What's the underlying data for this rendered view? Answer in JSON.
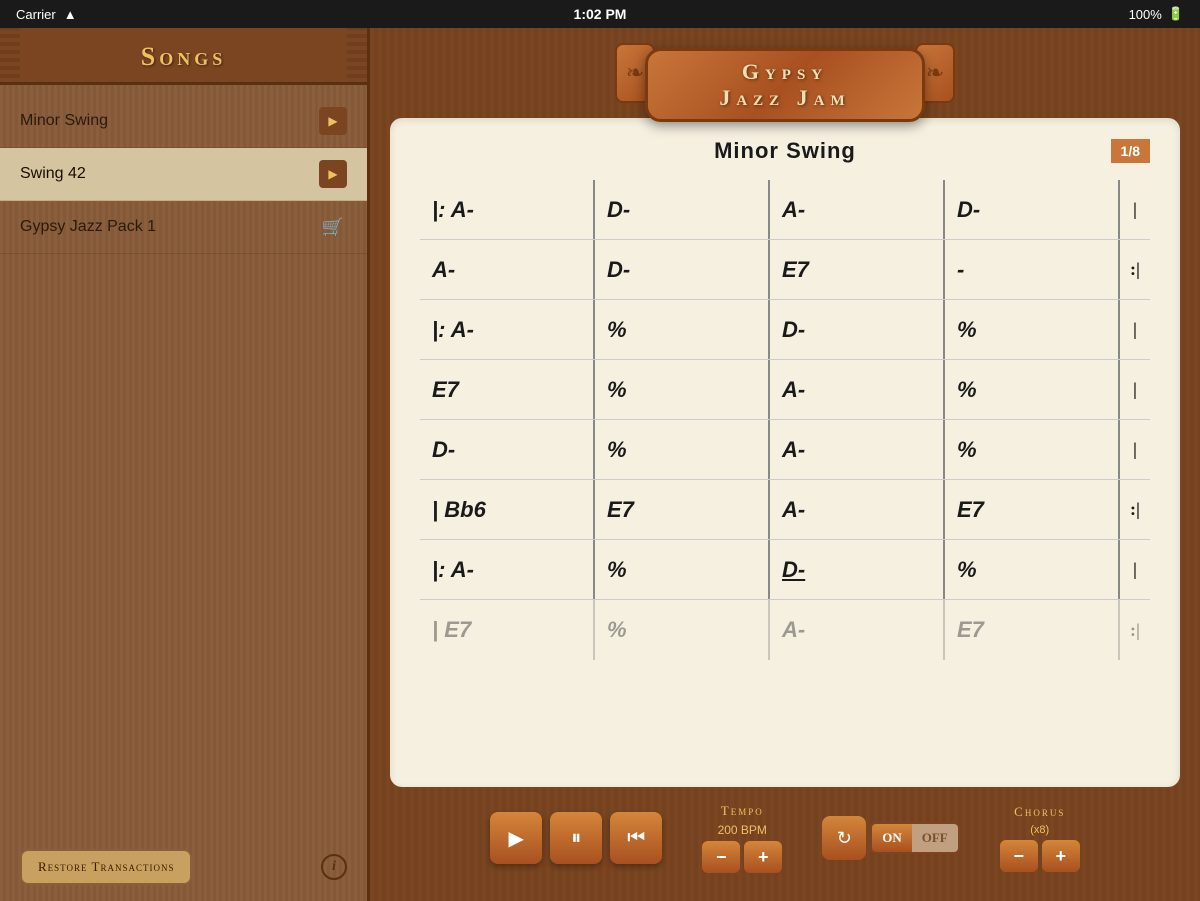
{
  "statusBar": {
    "carrier": "Carrier",
    "time": "1:02 PM",
    "battery": "100%"
  },
  "sidebar": {
    "title": "Songs",
    "songs": [
      {
        "id": 1,
        "name": "Minor Swing",
        "type": "play",
        "selected": false
      },
      {
        "id": 2,
        "name": "Swing 42",
        "type": "play",
        "selected": true
      },
      {
        "id": 3,
        "name": "Gypsy Jazz Pack 1",
        "type": "cart",
        "selected": false
      }
    ],
    "restoreButton": "Restore Transactions",
    "infoLabel": "i"
  },
  "appHeader": {
    "line1": "Gypsy",
    "line2": "Jazz Jam",
    "leftBracket": "❧",
    "rightBracket": "❧"
  },
  "sheet": {
    "songTitle": "Minor Swing",
    "pageIndicator": "1/8",
    "rows": [
      {
        "cells": [
          {
            "prefix": "|:",
            "text": "A-",
            "underline": false
          },
          {
            "prefix": "",
            "text": "D-",
            "underline": false
          },
          {
            "prefix": "",
            "text": "A-",
            "underline": false
          },
          {
            "prefix": "",
            "text": "D-",
            "underline": false
          }
        ],
        "end": "|"
      },
      {
        "cells": [
          {
            "prefix": "",
            "text": "A-",
            "underline": false
          },
          {
            "prefix": "",
            "text": "D-",
            "underline": false
          },
          {
            "prefix": "",
            "text": "E7",
            "underline": false
          },
          {
            "prefix": "",
            "text": "-",
            "underline": false
          }
        ],
        "end": ":|"
      },
      {
        "cells": [
          {
            "prefix": "|:",
            "text": "A-",
            "underline": false
          },
          {
            "prefix": "",
            "text": "%",
            "underline": false
          },
          {
            "prefix": "",
            "text": "D-",
            "underline": false
          },
          {
            "prefix": "",
            "text": "%",
            "underline": false
          }
        ],
        "end": "|"
      },
      {
        "cells": [
          {
            "prefix": "",
            "text": "E7",
            "underline": false
          },
          {
            "prefix": "",
            "text": "%",
            "underline": false
          },
          {
            "prefix": "",
            "text": "A-",
            "underline": false
          },
          {
            "prefix": "",
            "text": "%",
            "underline": false
          }
        ],
        "end": "|"
      },
      {
        "cells": [
          {
            "prefix": "",
            "text": "D-",
            "underline": false
          },
          {
            "prefix": "",
            "text": "%",
            "underline": false
          },
          {
            "prefix": "",
            "text": "A-",
            "underline": false
          },
          {
            "prefix": "",
            "text": "%",
            "underline": false
          }
        ],
        "end": "|"
      },
      {
        "cells": [
          {
            "prefix": "|",
            "text": "Bb6",
            "underline": false
          },
          {
            "prefix": "",
            "text": "E7",
            "underline": false
          },
          {
            "prefix": "",
            "text": "A-",
            "underline": false
          },
          {
            "prefix": "",
            "text": "E7",
            "underline": false
          }
        ],
        "end": ":|"
      },
      {
        "cells": [
          {
            "prefix": "|:",
            "text": "A-",
            "underline": false
          },
          {
            "prefix": "",
            "text": "%",
            "underline": false
          },
          {
            "prefix": "",
            "text": "D-",
            "underline": true
          },
          {
            "prefix": "",
            "text": "%",
            "underline": false
          }
        ],
        "end": "|"
      },
      {
        "cells": [
          {
            "prefix": "|",
            "text": "E7",
            "underline": false
          },
          {
            "prefix": "",
            "text": "%",
            "underline": false
          },
          {
            "prefix": "",
            "text": "A-",
            "underline": false
          },
          {
            "prefix": "",
            "text": "E7",
            "underline": false
          }
        ],
        "end": ":|",
        "partial": true
      }
    ]
  },
  "controls": {
    "playLabel": "▶",
    "pauseLabel": "⏸",
    "rewindLabel": "⏮",
    "tempoLabel": "Tempo",
    "tempoValue": "200 BPM",
    "tempoMinus": "−",
    "tempoPlus": "+",
    "loopLabel": "↻",
    "onLabel": "ON",
    "offLabel": "OFF",
    "chorusLabel": "Chorus",
    "chorusSub": "(x8)",
    "chorusMinus": "−",
    "chorusPlus": "+"
  }
}
